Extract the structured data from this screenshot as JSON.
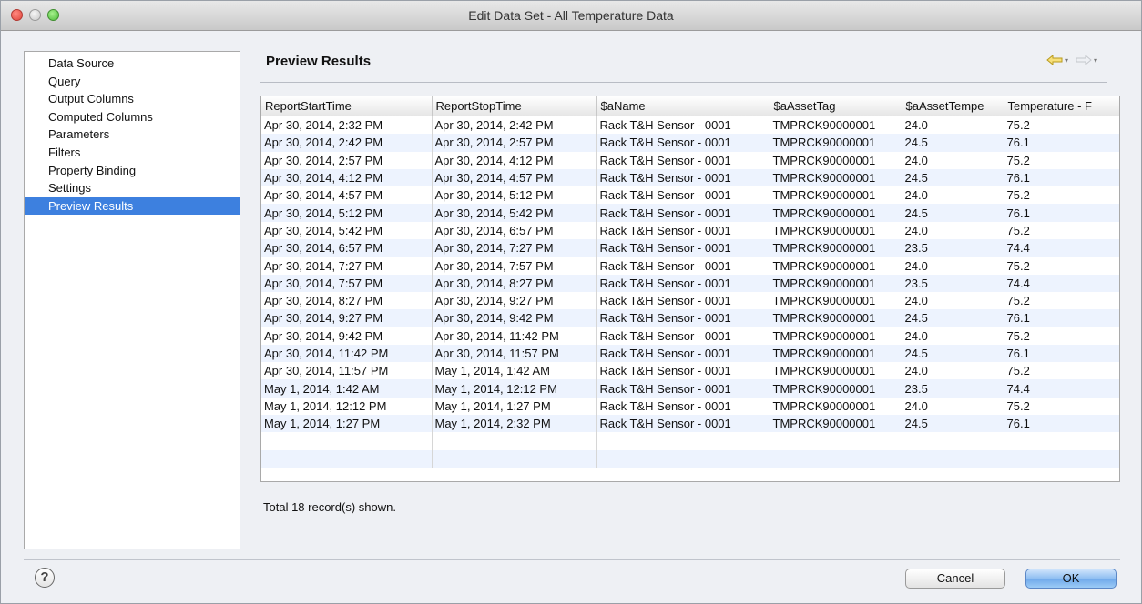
{
  "window": {
    "title": "Edit Data Set - All Temperature Data"
  },
  "nav": {
    "items": [
      {
        "label": "Data Source"
      },
      {
        "label": "Query"
      },
      {
        "label": "Output Columns"
      },
      {
        "label": "Computed Columns"
      },
      {
        "label": "Parameters"
      },
      {
        "label": "Filters"
      },
      {
        "label": "Property Binding"
      },
      {
        "label": "Settings"
      },
      {
        "label": "Preview Results"
      }
    ],
    "selected": "Preview Results"
  },
  "panel": {
    "title": "Preview Results",
    "back_icon": "back-arrow-icon",
    "forward_icon": "forward-arrow-icon"
  },
  "table": {
    "columns": [
      "ReportStartTime",
      "ReportStopTime",
      "$aName",
      "$aAssetTag",
      "$aAssetTempe",
      "Temperature - F"
    ],
    "rows": [
      [
        "Apr 30, 2014, 2:32 PM",
        "Apr 30, 2014, 2:42 PM",
        "Rack T&H Sensor - 0001",
        "TMPRCK90000001",
        "24.0",
        "75.2"
      ],
      [
        "Apr 30, 2014, 2:42 PM",
        "Apr 30, 2014, 2:57 PM",
        "Rack T&H Sensor - 0001",
        "TMPRCK90000001",
        "24.5",
        "76.1"
      ],
      [
        "Apr 30, 2014, 2:57 PM",
        "Apr 30, 2014, 4:12 PM",
        "Rack T&H Sensor - 0001",
        "TMPRCK90000001",
        "24.0",
        "75.2"
      ],
      [
        "Apr 30, 2014, 4:12 PM",
        "Apr 30, 2014, 4:57 PM",
        "Rack T&H Sensor - 0001",
        "TMPRCK90000001",
        "24.5",
        "76.1"
      ],
      [
        "Apr 30, 2014, 4:57 PM",
        "Apr 30, 2014, 5:12 PM",
        "Rack T&H Sensor - 0001",
        "TMPRCK90000001",
        "24.0",
        "75.2"
      ],
      [
        "Apr 30, 2014, 5:12 PM",
        "Apr 30, 2014, 5:42 PM",
        "Rack T&H Sensor - 0001",
        "TMPRCK90000001",
        "24.5",
        "76.1"
      ],
      [
        "Apr 30, 2014, 5:42 PM",
        "Apr 30, 2014, 6:57 PM",
        "Rack T&H Sensor - 0001",
        "TMPRCK90000001",
        "24.0",
        "75.2"
      ],
      [
        "Apr 30, 2014, 6:57 PM",
        "Apr 30, 2014, 7:27 PM",
        "Rack T&H Sensor - 0001",
        "TMPRCK90000001",
        "23.5",
        "74.4"
      ],
      [
        "Apr 30, 2014, 7:27 PM",
        "Apr 30, 2014, 7:57 PM",
        "Rack T&H Sensor - 0001",
        "TMPRCK90000001",
        "24.0",
        "75.2"
      ],
      [
        "Apr 30, 2014, 7:57 PM",
        "Apr 30, 2014, 8:27 PM",
        "Rack T&H Sensor - 0001",
        "TMPRCK90000001",
        "23.5",
        "74.4"
      ],
      [
        "Apr 30, 2014, 8:27 PM",
        "Apr 30, 2014, 9:27 PM",
        "Rack T&H Sensor - 0001",
        "TMPRCK90000001",
        "24.0",
        "75.2"
      ],
      [
        "Apr 30, 2014, 9:27 PM",
        "Apr 30, 2014, 9:42 PM",
        "Rack T&H Sensor - 0001",
        "TMPRCK90000001",
        "24.5",
        "76.1"
      ],
      [
        "Apr 30, 2014, 9:42 PM",
        "Apr 30, 2014, 11:42 PM",
        "Rack T&H Sensor - 0001",
        "TMPRCK90000001",
        "24.0",
        "75.2"
      ],
      [
        "Apr 30, 2014, 11:42 PM",
        "Apr 30, 2014, 11:57 PM",
        "Rack T&H Sensor - 0001",
        "TMPRCK90000001",
        "24.5",
        "76.1"
      ],
      [
        "Apr 30, 2014, 11:57 PM",
        "May 1, 2014, 1:42 AM",
        "Rack T&H Sensor - 0001",
        "TMPRCK90000001",
        "24.0",
        "75.2"
      ],
      [
        "May 1, 2014, 1:42 AM",
        "May 1, 2014, 12:12 PM",
        "Rack T&H Sensor - 0001",
        "TMPRCK90000001",
        "23.5",
        "74.4"
      ],
      [
        "May 1, 2014, 12:12 PM",
        "May 1, 2014, 1:27 PM",
        "Rack T&H Sensor - 0001",
        "TMPRCK90000001",
        "24.0",
        "75.2"
      ],
      [
        "May 1, 2014, 1:27 PM",
        "May 1, 2014, 2:32 PM",
        "Rack T&H Sensor - 0001",
        "TMPRCK90000001",
        "24.5",
        "76.1"
      ]
    ]
  },
  "summary": "Total 18 record(s) shown.",
  "footer": {
    "help_label": "?",
    "cancel_label": "Cancel",
    "ok_label": "OK"
  }
}
